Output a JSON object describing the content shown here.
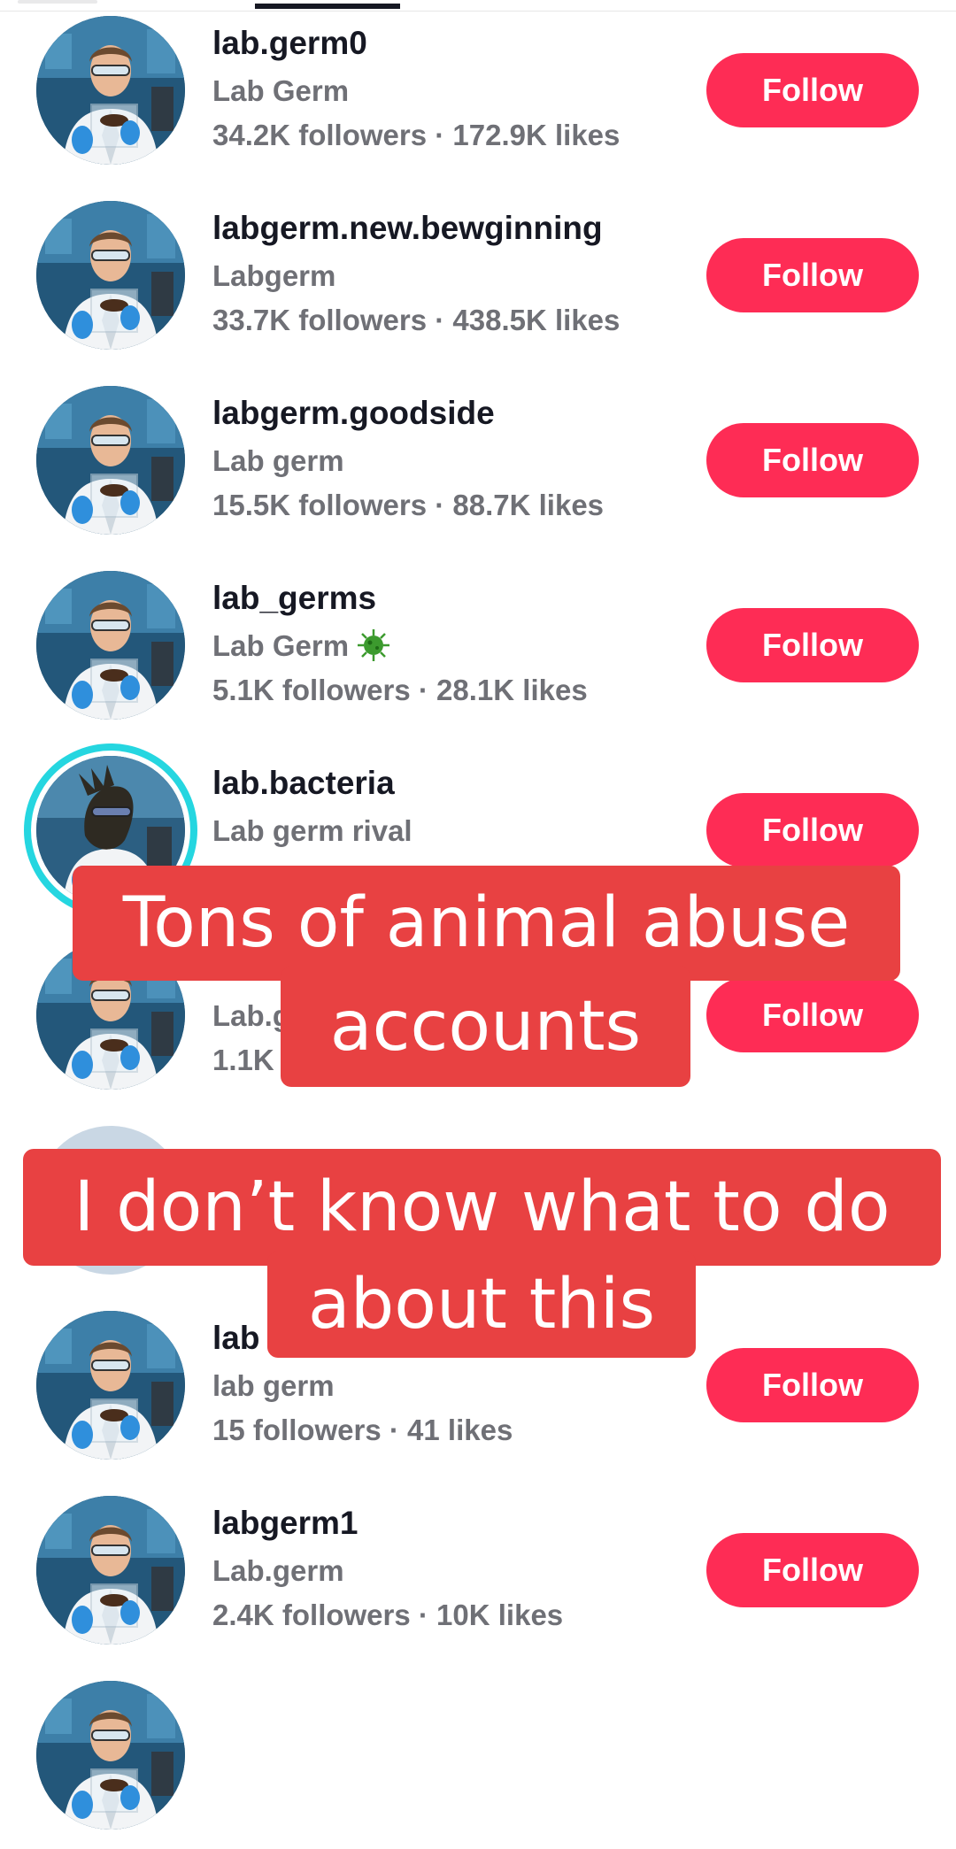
{
  "tabs": {
    "active_indicator": true
  },
  "users": [
    {
      "username": "lab.germ0",
      "display_name": "Lab Germ",
      "stats": "34.2K followers · 172.9K likes",
      "follow_label": "Follow"
    },
    {
      "username": "labgerm.new.bewginning",
      "display_name": "Labgerm",
      "stats": "33.7K followers · 438.5K likes",
      "follow_label": "Follow"
    },
    {
      "username": "labgerm.goodside",
      "display_name": "Lab germ",
      "stats": "15.5K followers · 88.7K likes",
      "follow_label": "Follow"
    },
    {
      "username": "lab_germs",
      "display_name": "Lab Germ",
      "stats": "5.1K followers · 28.1K likes",
      "follow_label": "Follow",
      "badge_icon": "virus-icon"
    },
    {
      "username": "lab.bacteria",
      "display_name": "Lab germ rival",
      "stats": "",
      "follow_label": "Follow",
      "avatar_ring_color": "#25d6e0"
    },
    {
      "username": "",
      "display_name": "Lab.g",
      "stats": "1.1K f",
      "follow_label": "Follow"
    },
    {
      "username": "",
      "display_name": "",
      "stats": "",
      "follow_label": ""
    },
    {
      "username": "lab",
      "display_name": "lab germ",
      "stats": "15 followers · 41 likes",
      "follow_label": "Follow"
    },
    {
      "username": "labgerm1",
      "display_name": "Lab.germ",
      "stats": "2.4K followers · 10K likes",
      "follow_label": "Follow"
    }
  ],
  "captions": {
    "line1a": "Tons of animal abuse",
    "line1b": "accounts",
    "line2a": "I don’t know what to do",
    "line2b": "about this"
  },
  "colors": {
    "follow_button": "#fe2c55",
    "caption_background": "#e84142",
    "username": "#161823",
    "secondary_text": "#6f7076"
  }
}
